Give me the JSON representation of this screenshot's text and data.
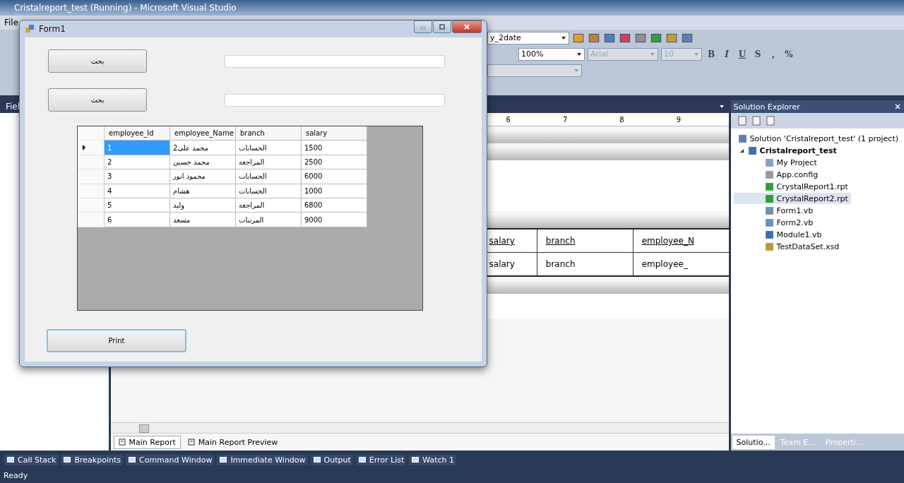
{
  "ide": {
    "title": "Cristalreport_test (Running) - Microsoft Visual Studio",
    "menu": [
      "File"
    ],
    "toolbar": {
      "report_combo": "y_2date",
      "zoom": "100%",
      "font": "Arial",
      "font_size": "10",
      "format_buttons": [
        "B",
        "I",
        "U",
        "S",
        ",",
        "%"
      ]
    },
    "left_panel": {
      "title": "Fiel"
    },
    "designer": {
      "ruler": [
        "6",
        "7",
        "8",
        "9"
      ],
      "sections": [
        {
          "kind": "header",
          "fields": [
            "salary",
            "branch",
            "employee_N"
          ]
        },
        {
          "kind": "details",
          "fields": [
            "salary",
            "branch",
            "employee_"
          ]
        }
      ],
      "tabs": [
        {
          "label": "Main Report",
          "selected": true
        },
        {
          "label": "Main Report Preview",
          "selected": false
        }
      ]
    },
    "solution_explorer": {
      "title": "Solution Explorer",
      "tree": [
        {
          "label": "Solution 'Cristalreport_test' (1 project)",
          "kind": "solution",
          "selected": false,
          "children": [
            {
              "label": "Cristalreport_test",
              "kind": "project",
              "selected": false,
              "expanded": true,
              "children": [
                {
                  "label": "My Project",
                  "kind": "properties",
                  "selected": false
                },
                {
                  "label": "App.config",
                  "kind": "config",
                  "selected": false
                },
                {
                  "label": "CrystalReport1.rpt",
                  "kind": "report",
                  "selected": false
                },
                {
                  "label": "CrystalReport2.rpt",
                  "kind": "report",
                  "selected": true
                },
                {
                  "label": "Form1.vb",
                  "kind": "form",
                  "selected": false
                },
                {
                  "label": "Form2.vb",
                  "kind": "form",
                  "selected": false
                },
                {
                  "label": "Module1.vb",
                  "kind": "module",
                  "selected": false
                },
                {
                  "label": "TestDataSet.xsd",
                  "kind": "dataset",
                  "selected": false
                }
              ]
            }
          ]
        }
      ],
      "tabs": [
        {
          "label": "Solutio...",
          "selected": true
        },
        {
          "label": "Team E...",
          "selected": false
        },
        {
          "label": "Properti...",
          "selected": false
        }
      ]
    },
    "tool_tabs": [
      "Call Stack",
      "Breakpoints",
      "Command Window",
      "Immediate Window",
      "Output",
      "Error List",
      "Watch 1"
    ],
    "status": "Ready"
  },
  "form": {
    "title": "Form1",
    "search_rows": [
      {
        "button": "بحث"
      },
      {
        "button": "بحث"
      }
    ],
    "grid": {
      "columns": [
        "employee_Id",
        "employee_Name",
        "branch",
        "salary"
      ],
      "rows": [
        {
          "current": true,
          "cells": [
            {
              "text": "1",
              "selected": true
            },
            {
              "text": "محمد على2",
              "selected": false
            },
            {
              "text": "الحسابات",
              "selected": false
            },
            {
              "text": "1500",
              "selected": false
            }
          ]
        },
        {
          "current": false,
          "cells": [
            {
              "text": "2",
              "selected": false
            },
            {
              "text": "محمد حسين",
              "selected": false
            },
            {
              "text": "المراجعة",
              "selected": false
            },
            {
              "text": "2500",
              "selected": false
            }
          ]
        },
        {
          "current": false,
          "cells": [
            {
              "text": "3",
              "selected": false
            },
            {
              "text": "محمود انور",
              "selected": false
            },
            {
              "text": "الحسابات",
              "selected": false
            },
            {
              "text": "6000",
              "selected": false
            }
          ]
        },
        {
          "current": false,
          "cells": [
            {
              "text": "4",
              "selected": false
            },
            {
              "text": "هشام",
              "selected": false
            },
            {
              "text": "الحسابات",
              "selected": false
            },
            {
              "text": "1000",
              "selected": false
            }
          ]
        },
        {
          "current": false,
          "cells": [
            {
              "text": "5",
              "selected": false
            },
            {
              "text": "وليد",
              "selected": false
            },
            {
              "text": "المراجعة",
              "selected": false
            },
            {
              "text": "6800",
              "selected": false
            }
          ]
        },
        {
          "current": false,
          "cells": [
            {
              "text": "6",
              "selected": false
            },
            {
              "text": "مسعد",
              "selected": false
            },
            {
              "text": "المرتبات",
              "selected": false
            },
            {
              "text": "9000",
              "selected": false
            }
          ]
        }
      ]
    },
    "print_button": "Print"
  }
}
